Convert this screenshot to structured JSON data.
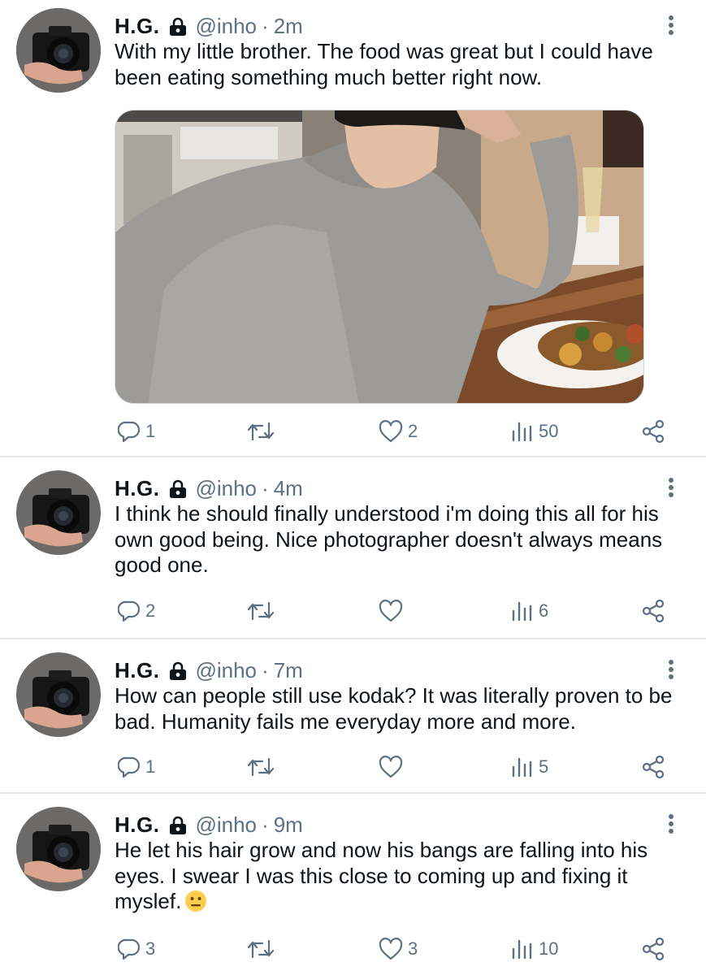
{
  "tweets": [
    {
      "name": "H.G.",
      "handle": "@inho",
      "separator": "·",
      "time": "2m",
      "text": "With my little brother. The food was great but I could have been eating something much better right now.",
      "has_photo": true,
      "replies": "1",
      "retweets": "",
      "likes": "2",
      "views": "50"
    },
    {
      "name": "H.G.",
      "handle": "@inho",
      "separator": "·",
      "time": "4m",
      "text": "I think he should finally understood i'm doing this all for his own good being. Nice photographer doesn't always means good one.",
      "has_photo": false,
      "replies": "2",
      "retweets": "",
      "likes": "",
      "views": "6"
    },
    {
      "name": "H.G.",
      "handle": "@inho",
      "separator": "·",
      "time": "7m",
      "text": "How can people still use kodak? It was literally proven to be bad. Humanity fails me everyday more and more.",
      "has_photo": false,
      "replies": "1",
      "retweets": "",
      "likes": "",
      "views": "5"
    },
    {
      "name": "H.G.",
      "handle": "@inho",
      "separator": "·",
      "time": "9m",
      "text": "He let his hair grow and now his bangs are falling into his eyes. I swear I was this close to coming up and fixing it myslef.",
      "has_photo": false,
      "emoji": "neutral-face",
      "replies": "3",
      "retweets": "",
      "likes": "3",
      "views": "10"
    }
  ],
  "icons": {
    "lock": "lock-icon",
    "more": "more-vertical-icon",
    "reply": "reply-icon",
    "retweet": "retweet-icon",
    "like": "heart-icon",
    "views": "views-bar-chart-icon",
    "share": "share-icon"
  },
  "colors": {
    "text": "#0f1419",
    "secondary": "#5b7083",
    "divider": "#e6e6e6"
  }
}
